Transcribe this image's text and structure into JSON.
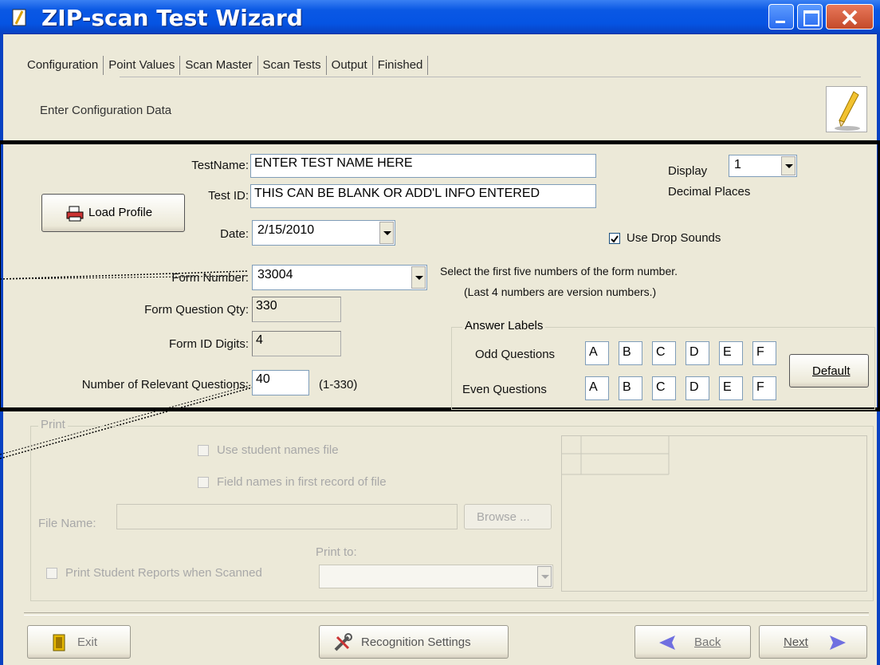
{
  "window": {
    "title": "ZIP-scan Test Wizard"
  },
  "tabs": [
    "Configuration",
    "Point Values",
    "Scan Master",
    "Scan Tests",
    "Output",
    "Finished"
  ],
  "subtitle": "Enter Configuration Data",
  "config": {
    "load_profile_label": "Load Profile",
    "testname_label": "TestName:",
    "testname_value": "ENTER TEST NAME HERE",
    "testid_label": "Test ID:",
    "testid_value": "THIS CAN BE BLANK OR ADD'L INFO ENTERED",
    "date_label": "Date:",
    "date_value": "2/15/2010",
    "display_label": "Display",
    "display_value": "1",
    "decimal_places_label": "Decimal Places",
    "drop_sounds_label": "Use Drop Sounds",
    "drop_sounds_checked": true,
    "form_number_label": "Form Number:",
    "form_number_value": "33004",
    "form_hint_1": "Select the first five numbers of the form number.",
    "form_hint_2": "(Last 4 numbers are version numbers.)",
    "form_question_qty_label": "Form Question Qty:",
    "form_question_qty_value": "330",
    "form_id_digits_label": "Form ID Digits:",
    "form_id_digits_value": "4",
    "relevant_questions_label": "Number of Relevant Questions:",
    "relevant_questions_value": "40",
    "relevant_questions_range": "(1-330)"
  },
  "answer_labels": {
    "group_label": "Answer Labels",
    "odd_label": "Odd Questions",
    "even_label": "Even Questions",
    "odd": [
      "A",
      "B",
      "C",
      "D",
      "E",
      "F"
    ],
    "even": [
      "A",
      "B",
      "C",
      "D",
      "E",
      "F"
    ],
    "default_label": "Default"
  },
  "print": {
    "group_label": "Print",
    "use_names_label": "Use student names file",
    "field_names_label": "Field names in first record of file",
    "file_name_label": "File Name:",
    "browse_label": "Browse ...",
    "print_to_label": "Print to:",
    "print_reports_label": "Print Student Reports when Scanned"
  },
  "footer": {
    "exit_label": "Exit",
    "recognition_label": "Recognition Settings",
    "back_label": "Back",
    "next_label": "Next"
  },
  "colors": {
    "title_bar": "#0554e3",
    "window_bg": "#ece9d8",
    "accent_arrow": "#5b5bdc"
  }
}
